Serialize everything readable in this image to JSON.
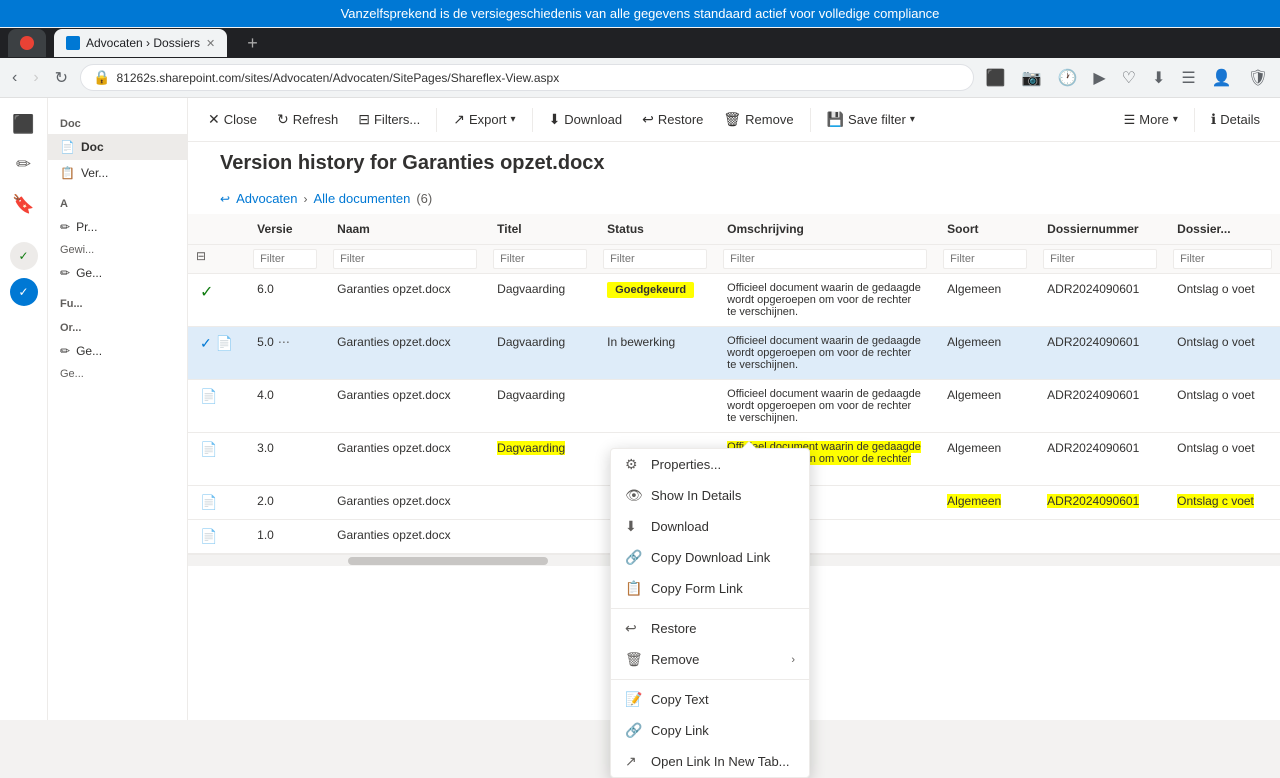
{
  "banner": {
    "text": "Vanzelfsprekend is de versiegeschiedenis van alle gegevens standaard actief voor volledige compliance"
  },
  "browser": {
    "tab_label": "Advocaten › Dossiers",
    "url": "81262s.sharepoint.com/sites/Advocaten/Advocaten/SitePages/Shareflex-View.aspx",
    "new_tab": "+"
  },
  "toolbar": {
    "close_label": "Close",
    "refresh_label": "Refresh",
    "filters_label": "Filters...",
    "export_label": "Export",
    "download_label": "Download",
    "restore_label": "Restore",
    "remove_label": "Remove",
    "save_filter_label": "Save filter",
    "more_label": "More",
    "details_label": "Details"
  },
  "page": {
    "title": "Version history for Garanties opzet.docx",
    "breadcrumb_root": "Advocaten",
    "breadcrumb_nav": "Alle documenten",
    "breadcrumb_count": "(6)"
  },
  "table": {
    "columns": [
      "",
      "Versie",
      "Naam",
      "Titel",
      "Status",
      "Omschrijving",
      "Soort",
      "Dossiernummer",
      "Dossier..."
    ],
    "filters": [
      "",
      "",
      "",
      "",
      "",
      "",
      "",
      "",
      ""
    ],
    "rows": [
      {
        "check": "✓",
        "versie": "6.0",
        "naam": "Garanties opzet.docx",
        "titel": "Dagvaarding",
        "status": "Goedgekeurd",
        "status_type": "badge",
        "omschrijving": "Officieel document waarin de gedaagde wordt opgeroepen om voor de rechter te verschijnen.",
        "soort": "Algemeen",
        "dossiernummer": "ADR2024090601",
        "dossier": "Ontslag o voet"
      },
      {
        "check": "✓",
        "doc": "📄",
        "versie": "5.0",
        "naam": "Garanties opzet.docx",
        "titel": "Dagvaarding",
        "status": "In bewerking",
        "status_type": "text",
        "omschrijving": "Officieel document waarin de gedaagde wordt opgeroepen om voor de rechter te verschijnen.",
        "soort": "Algemeen",
        "dossiernummer": "ADR2024090601",
        "dossier": "Ontslag o voet"
      },
      {
        "doc": "📄",
        "versie": "4.0",
        "naam": "Garanties opzet.docx",
        "titel": "Dagvaarding",
        "status": "",
        "status_type": "text",
        "omschrijving": "Officieel document waarin de gedaagde wordt opgeroepen om voor de rechter te verschijnen.",
        "soort": "Algemeen",
        "dossiernummer": "ADR2024090601",
        "dossier": "Ontslag o voet"
      },
      {
        "doc": "📄",
        "versie": "3.0",
        "naam": "Garanties opzet.docx",
        "titel": "Dagvaarding",
        "status": "",
        "status_type": "highlight",
        "omschrijving_highlight": "Officieel document waarin de gedaagde wordt opgeroepen om voor de rechter te verschijnen.",
        "soort": "Algemeen",
        "dossiernummer": "ADR2024090601",
        "dossier": "Ontslag o voet"
      },
      {
        "doc": "📄",
        "versie": "2.0",
        "naam": "Garanties opzet.docx",
        "titel": "",
        "status": "",
        "status_type": "text",
        "omschrijving": "",
        "soort_highlight": "Algemeen",
        "dossiernummer_highlight": "ADR2024090601",
        "dossier_highlight": "Ontslag c voet"
      },
      {
        "doc": "📄",
        "versie": "1.0",
        "naam": "Garanties opzet.docx",
        "titel": "",
        "status": "",
        "status_type": "text",
        "omschrijving": "",
        "soort": "",
        "dossiernummer": "",
        "dossier": ""
      }
    ]
  },
  "context_menu": {
    "items": [
      {
        "icon": "⚙",
        "label": "Properties..."
      },
      {
        "icon": "👁",
        "label": "Show In Details"
      },
      {
        "icon": "⬇",
        "label": "Download"
      },
      {
        "icon": "🔗",
        "label": "Copy Download Link"
      },
      {
        "icon": "📋",
        "label": "Copy Form Link"
      },
      {
        "separator": true
      },
      {
        "icon": "↩",
        "label": "Restore"
      },
      {
        "icon": "🗑",
        "label": "Remove",
        "arrow": "›"
      },
      {
        "separator": true
      },
      {
        "icon": "📝",
        "label": "Copy Text"
      },
      {
        "icon": "🔗",
        "label": "Copy Link"
      },
      {
        "icon": "↗",
        "label": "Open Link In New Tab..."
      }
    ]
  },
  "sidebar": {
    "icons": [
      "⬛",
      "✏",
      "🔖",
      "✓",
      "✓"
    ]
  }
}
